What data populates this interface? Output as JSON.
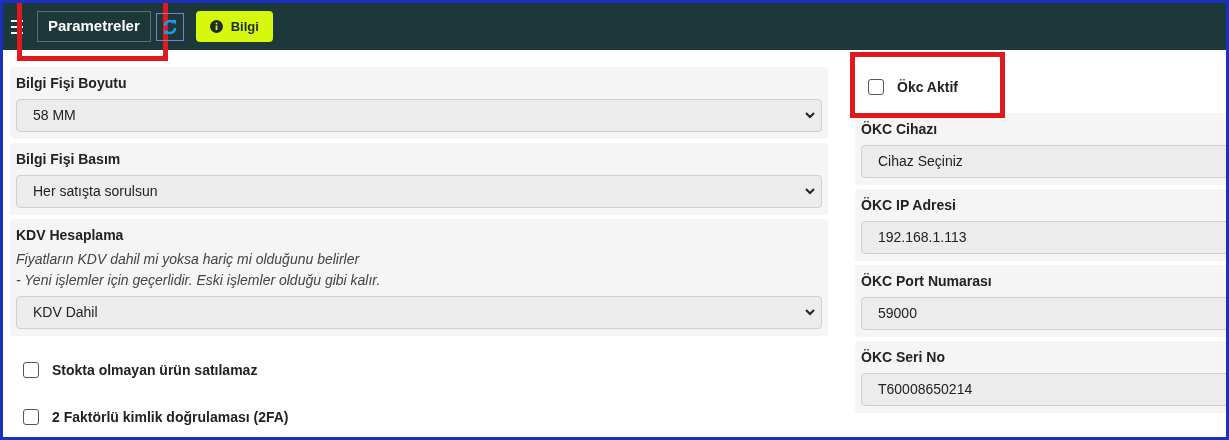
{
  "header": {
    "buttons": [
      {
        "kind": "menu",
        "highlighted": false
      },
      {
        "kind": "tab",
        "label": "Parametreler",
        "highlighted": true
      },
      {
        "kind": "refresh",
        "highlighted": false
      },
      {
        "kind": "info",
        "label": "Bilgi",
        "highlighted": false
      }
    ]
  },
  "left": [
    {
      "kind": "select",
      "label": "Bilgi Fişi Boyutu",
      "value": "58 MM"
    },
    {
      "kind": "select",
      "label": "Bilgi Fişi Basım",
      "value": "Her satışta sorulsun"
    },
    {
      "kind": "select",
      "label": "KDV Hesaplama",
      "description": [
        "Fiyatların KDV dahil mi yoksa hariç mi olduğunu belirler",
        "- Yeni işlemler için geçerlidir. Eski işlemler olduğu gibi kalır."
      ],
      "value": "KDV Dahil"
    },
    {
      "kind": "checkbox",
      "label": "Stokta olmayan ürün satılamaz",
      "checked": false,
      "highlighted": false
    },
    {
      "kind": "checkbox",
      "label": "2 Faktörlü kimlik doğrulaması (2FA)",
      "checked": false,
      "highlighted": false
    }
  ],
  "right": [
    {
      "kind": "checkbox",
      "label": "Ökc Aktif",
      "checked": false,
      "highlighted": true
    },
    {
      "kind": "field",
      "label": "ÖKC Cihazı",
      "value": "Cihaz Seçiniz"
    },
    {
      "kind": "field",
      "label": "ÖKC IP Adresi",
      "value": "192.168.1.113"
    },
    {
      "kind": "field",
      "label": "ÖKC Port Numarası",
      "value": "59000"
    },
    {
      "kind": "field",
      "label": "ÖKC Seri No",
      "value": "T60008650214"
    }
  ]
}
